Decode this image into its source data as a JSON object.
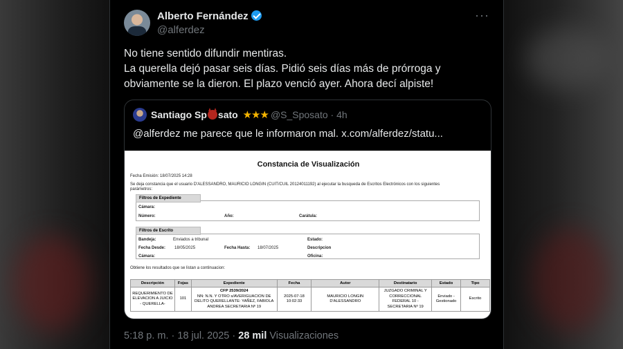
{
  "tweet": {
    "author": {
      "name": "Alberto Fernández",
      "handle": "@alferdez"
    },
    "text_lines": [
      "No tiene sentido difundir mentiras.",
      "La querella dejó pasar seis días. Pidió seis días más de prórroga y",
      "obviamente se la dieron. El plazo venció ayer. Ahora decí alpiste!"
    ],
    "more_label": "···",
    "footer": {
      "time": "5:18 p. m.",
      "sep": " · ",
      "date": "18 jul. 2025",
      "views_count": "28 mil",
      "views_label": " Visualizaciones"
    }
  },
  "quote": {
    "name_part1": "Santiago Sp",
    "name_part2": "sato",
    "stars": "★★★",
    "handle": "@S_Sposato",
    "time": "· 4h",
    "text": "@alferdez me parece que le informaron mal.  x.com/alferdez/statu..."
  },
  "document": {
    "title": "Constancia de Visualización",
    "fecha_emision": "Fecha Emisión:    18/07/2025 14:28",
    "intro_line1": "Se deja constancia que el usuario D'ALESSANDRO, MAURICIO LONGIN (CUIT/CUIL 20124011192) al ejecutar la busqueda de Escritos Electrónicos con los siguientes",
    "intro_line2": "parámetros:",
    "filtros_expediente": "Filtros de Expediente",
    "camara_label": "Cámara:",
    "numero_label": "Número:",
    "anio_label": "Año:",
    "caratula_label": "Carátula:",
    "filtros_escrito": "Filtros de Escrito",
    "bandeja_label": "Bandeja:",
    "bandeja_value": "Enviados a tribunal",
    "estado_label": "Estado:",
    "fecha_desde_label": "Fecha Desde:",
    "fecha_desde_value": "18/05/2025",
    "fecha_hasta_label": "Fecha Hasta:",
    "fecha_hasta_value": "18/07/2025",
    "descripcion_label": "Descripcion",
    "camara2_label": "Cámara:",
    "oficina_label": "Oficina:",
    "results_intro": "Obtiene los resultados que se listan a continuacion:",
    "table": {
      "headers": [
        "Descripción",
        "Fojas",
        "Expediente",
        "Fecha",
        "Autor",
        "Destinatario",
        "Estado",
        "Tipo"
      ],
      "row": {
        "descripcion": "REQUERIMIENTO DE ELEVACION A JUICIO - QUERELLA-",
        "fojas": "101",
        "expediente_num": "CFP 2539/2024",
        "expediente_desc": "NN: N.N. Y OTRO s/AVERIGUACION DE DELITO QUERELLANTE: YAÑEZ, FABIOLA ANDREA SECRETARIA Nº 19",
        "fecha": "2025-07-18 10:02:33",
        "autor": "MAURICIO LONGIN D'ALESSANDRO",
        "destinatario": "JUZGADO CRIMINAL Y CORRECCIONAL FEDERAL 10 - SECRETARIA Nº 19",
        "estado": "Enviado - Gestionado",
        "tipo": "Escrito"
      }
    }
  }
}
